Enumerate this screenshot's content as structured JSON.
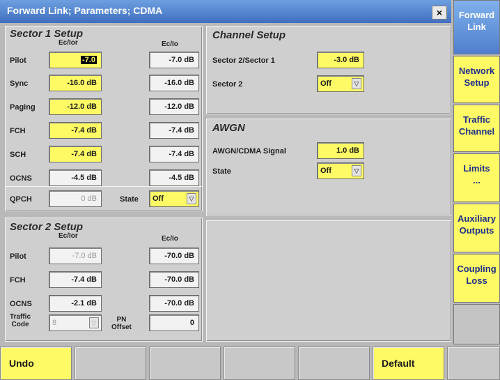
{
  "window": {
    "title": "Forward Link; Parameters; CDMA",
    "close": "×"
  },
  "sector1": {
    "title": "Sector 1 Setup",
    "col_ecior": "Ec/Ior",
    "col_ecio": "Ec/Io",
    "rows": [
      {
        "label": "Pilot",
        "ecior": "-7.0",
        "ecio": "-7.0 dB"
      },
      {
        "label": "Sync",
        "ecior": "-16.0 dB",
        "ecio": "-16.0 dB"
      },
      {
        "label": "Paging",
        "ecior": "-12.0 dB",
        "ecio": "-12.0 dB"
      },
      {
        "label": "FCH",
        "ecior": "-7.4 dB",
        "ecio": "-7.4 dB"
      },
      {
        "label": "SCH",
        "ecior": "-7.4 dB",
        "ecio": "-7.4 dB"
      },
      {
        "label": "OCNS",
        "ecior": "-4.5 dB",
        "ecio": "-4.5 dB"
      }
    ],
    "qpch": {
      "label": "QPCH",
      "value": "0 dB",
      "state_label": "State",
      "state_value": "Off"
    }
  },
  "sector2": {
    "title": "Sector 2 Setup",
    "col_ecior": "Ec/Ior",
    "col_ecio": "Ec/Io",
    "rows": [
      {
        "label": "Pilot",
        "ecior": "-7.0 dB",
        "ecio": "-70.0 dB"
      },
      {
        "label": "FCH",
        "ecior": "-7.4 dB",
        "ecio": "-70.0 dB"
      },
      {
        "label": "OCNS",
        "ecior": "-2.1 dB",
        "ecio": "-70.0 dB"
      }
    ],
    "traffic_code_label_1": "Traffic",
    "traffic_code_label_2": "Code",
    "traffic_code_value": "8",
    "pn_label_1": "PN",
    "pn_label_2": "Offset",
    "pn_value": "0"
  },
  "channel": {
    "title": "Channel Setup",
    "ratio_label": "Sector 2/Sector 1",
    "ratio_value": "-3.0 dB",
    "sector2_label": "Sector 2",
    "sector2_value": "Off"
  },
  "awgn": {
    "title": "AWGN",
    "signal_label": "AWGN/CDMA Signal",
    "signal_value": "1.0 dB",
    "state_label": "State",
    "state_value": "Off"
  },
  "sidebar": {
    "items": [
      {
        "line1": "Forward",
        "line2": "Link"
      },
      {
        "line1": "Network",
        "line2": "Setup"
      },
      {
        "line1": "Traffic",
        "line2": "Channel"
      },
      {
        "line1": "Limits",
        "line2": "..."
      },
      {
        "line1": "Auxiliary",
        "line2": "Outputs"
      },
      {
        "line1": "Coupling",
        "line2": "Loss"
      }
    ]
  },
  "softkeys": {
    "undo": "Undo",
    "default": "Default"
  },
  "colors": {
    "highlight": "#fdfa66",
    "title_bar": "#4f7fcc",
    "panel": "#cfcfcf"
  }
}
